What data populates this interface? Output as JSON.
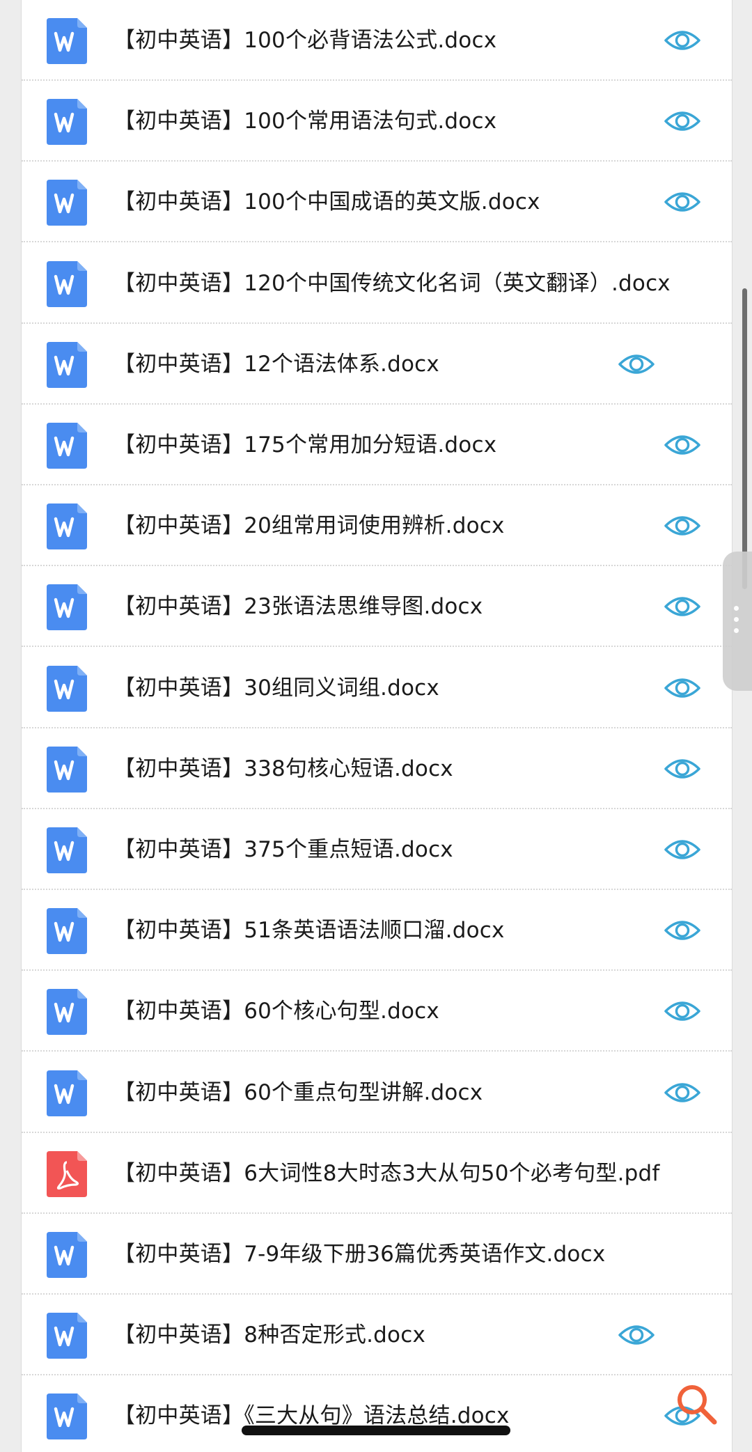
{
  "files": [
    {
      "name": "【初中英语】100个必背语法公式.docx",
      "type": "word",
      "preview": true
    },
    {
      "name": "【初中英语】100个常用语法句式.docx",
      "type": "word",
      "preview": true
    },
    {
      "name": "【初中英语】100个中国成语的英文版.docx",
      "type": "word",
      "preview": true
    },
    {
      "name": "【初中英语】120个中国传统文化名词（英文翻译）.docx",
      "type": "word",
      "preview": false
    },
    {
      "name": "【初中英语】12个语法体系.docx",
      "type": "word",
      "preview": true,
      "preview_inset": true
    },
    {
      "name": "【初中英语】175个常用加分短语.docx",
      "type": "word",
      "preview": true
    },
    {
      "name": "【初中英语】20组常用词使用辨析.docx",
      "type": "word",
      "preview": true
    },
    {
      "name": "【初中英语】23张语法思维导图.docx",
      "type": "word",
      "preview": true
    },
    {
      "name": "【初中英语】30组同义词组.docx",
      "type": "word",
      "preview": true
    },
    {
      "name": "【初中英语】338句核心短语.docx",
      "type": "word",
      "preview": true
    },
    {
      "name": "【初中英语】375个重点短语.docx",
      "type": "word",
      "preview": true
    },
    {
      "name": "【初中英语】51条英语语法顺口溜.docx",
      "type": "word",
      "preview": true
    },
    {
      "name": "【初中英语】60个核心句型.docx",
      "type": "word",
      "preview": true
    },
    {
      "name": "【初中英语】60个重点句型讲解.docx",
      "type": "word",
      "preview": true
    },
    {
      "name": "【初中英语】6大词性8大时态3大从句50个必考句型.pdf",
      "type": "pdf",
      "preview": false
    },
    {
      "name": "【初中英语】7-9年级下册36篇优秀英语作文.docx",
      "type": "word",
      "preview": false
    },
    {
      "name": "【初中英语】8种否定形式.docx",
      "type": "word",
      "preview": true,
      "preview_inset": true
    },
    {
      "name": "【初中英语】《三大从句》语法总结.docx",
      "type": "word",
      "preview": true
    }
  ],
  "icons": {
    "word": "word-file-icon",
    "pdf": "pdf-file-icon",
    "preview": "eye-icon",
    "search": "search-icon"
  },
  "colors": {
    "word": "#4a8cf0",
    "pdf": "#f25555",
    "eye": "#3aa6d6",
    "search": "#f0623a"
  }
}
